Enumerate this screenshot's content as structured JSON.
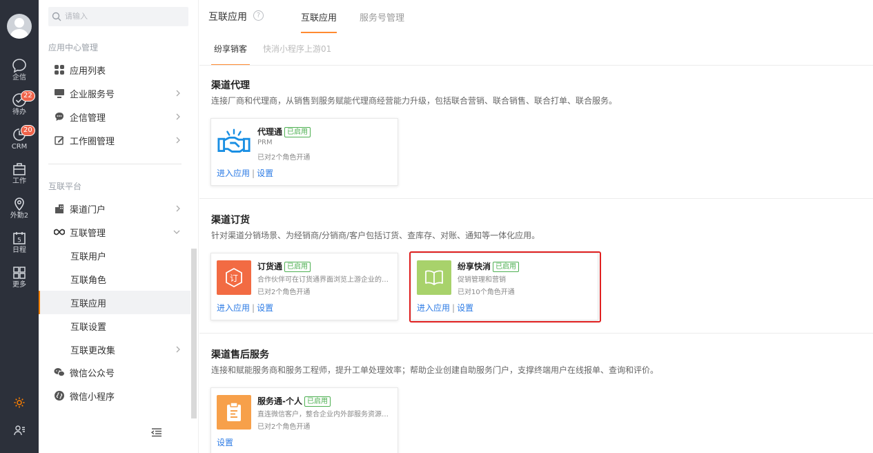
{
  "rail": {
    "items": [
      {
        "label": "企信",
        "icon": "chat-bubble-icon"
      },
      {
        "label": "待办",
        "icon": "check-circle-icon",
        "badge": "22"
      },
      {
        "label": "CRM",
        "icon": "crm-icon",
        "badge": "20"
      },
      {
        "label": "工作",
        "icon": "briefcase-icon"
      },
      {
        "label": "外勤2",
        "icon": "location-pin-icon"
      },
      {
        "label": "日程",
        "icon": "calendar-icon",
        "day": "5"
      },
      {
        "label": "更多",
        "icon": "grid-icon"
      }
    ],
    "bottom": [
      {
        "icon": "gear-icon",
        "color": "#ff8000"
      },
      {
        "icon": "user-list-icon"
      }
    ]
  },
  "sidebar": {
    "search_placeholder": "请输入",
    "group1": "应用中心管理",
    "group1_items": [
      {
        "label": "应用列表",
        "icon": "apps-icon"
      },
      {
        "label": "企业服务号",
        "icon": "monitor-icon",
        "chevron": true
      },
      {
        "label": "企信管理",
        "icon": "message-icon",
        "chevron": true
      },
      {
        "label": "工作圈管理",
        "icon": "edit-icon",
        "chevron": true
      }
    ],
    "group2": "互联平台",
    "group2_items": [
      {
        "label": "渠道门户",
        "icon": "building-icon",
        "chevron": true
      },
      {
        "label": "互联管理",
        "icon": "infinity-icon",
        "chevron": true,
        "expanded": true
      }
    ],
    "sub_items": [
      {
        "label": "互联用户"
      },
      {
        "label": "互联角色"
      },
      {
        "label": "互联应用",
        "active": true
      },
      {
        "label": "互联设置"
      },
      {
        "label": "互联更改集",
        "chevron": true
      }
    ],
    "bottom_items": [
      {
        "label": "微信公众号",
        "icon": "wechat-icon"
      },
      {
        "label": "微信小程序",
        "icon": "mini-program-icon"
      }
    ]
  },
  "main": {
    "title": "互联应用",
    "help_glyph": "?",
    "tabs": [
      {
        "label": "互联应用",
        "active": true
      },
      {
        "label": "服务号管理"
      }
    ],
    "subtabs": [
      {
        "label": "纷享销客",
        "active": true
      },
      {
        "label": "快消小程序上游01"
      }
    ],
    "sections": [
      {
        "title": "渠道代理",
        "desc": "连接厂商和代理商，从销售到服务赋能代理商经营能力升级，包括联合营销、联合销售、联合打单、联合服务。"
      },
      {
        "title": "渠道订货",
        "desc": "针对渠道分销场景、为经销商/分销商/客户包括订货、查库存、对账、通知等一体化应用。"
      },
      {
        "title": "渠道售后服务",
        "desc": "连接和赋能服务商和服务工程师，提升工单处理效率；帮助企业创建自助服务门户，支撑终端用户在线报单、查询和评价。"
      }
    ],
    "cards": [
      {
        "name": "代理通",
        "tag": "已启用",
        "desc": "PRM",
        "roles": "已对2个角色开通",
        "enter": "进入应用",
        "sep": "|",
        "settings": "设置",
        "icon": "handshake-icon"
      },
      {
        "name": "订货通",
        "tag": "已启用",
        "desc": "合作伙伴可在订货通界面浏览上游企业的商品",
        "roles": "已对2个角色开通",
        "enter": "进入应用",
        "sep": "|",
        "settings": "设置",
        "icon": "order-icon",
        "color": "#f26b43",
        "glyph": "订"
      },
      {
        "name": "纷享快消",
        "tag": "已启用",
        "desc": "促销管理和营销",
        "roles": "已对10个角色开通",
        "enter": "进入应用",
        "sep": "|",
        "settings": "设置",
        "icon": "book-icon",
        "color": "#a8d26b"
      },
      {
        "name": "服务通-个人",
        "tag": "已启用",
        "desc": "直连微信客户，整合企业内外部服务资源，实现服务全流程管理",
        "roles": "已对2个角色开通",
        "settings": "设置",
        "icon": "clipboard-icon",
        "color": "#f7a04a"
      }
    ]
  }
}
